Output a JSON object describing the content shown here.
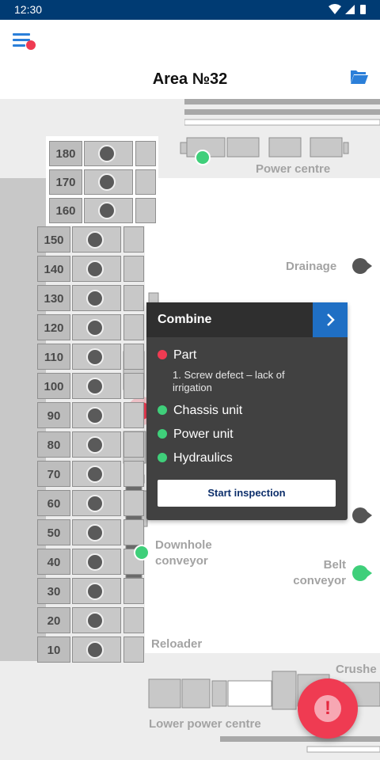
{
  "status_bar": {
    "time": "12:30"
  },
  "header": {
    "title": "Area №32"
  },
  "slots": [
    "180",
    "170",
    "160",
    "150",
    "140",
    "130",
    "120",
    "110",
    "100",
    "90",
    "80",
    "70",
    "60",
    "50",
    "40",
    "30",
    "20",
    "10"
  ],
  "map_labels": {
    "power_centre": "Power centre",
    "drainage": "Drainage",
    "downhole_conveyor": "Downhole\nconveyor",
    "belt_conveyor": "Belt\nconveyor",
    "reloader": "Reloader",
    "crusher": "Crushe",
    "lower_power_centre": "Lower power centre"
  },
  "popup": {
    "title": "Combine",
    "items": [
      {
        "label": "Part",
        "status": "fault",
        "detail": "1. Screw defect – lack of irrigation"
      },
      {
        "label": "Chassis unit",
        "status": "ok"
      },
      {
        "label": "Power unit",
        "status": "ok"
      },
      {
        "label": "Hydraulics",
        "status": "ok"
      }
    ],
    "action_label": "Start inspection"
  },
  "fab": {
    "icon": "alert-icon",
    "glyph": "!"
  },
  "colors": {
    "status_bar": "#003b73",
    "accent_blue": "#1f6fc4",
    "ok_green": "#3fcf7a",
    "fault_red": "#ef3b52",
    "map_bg": "#ededed"
  }
}
